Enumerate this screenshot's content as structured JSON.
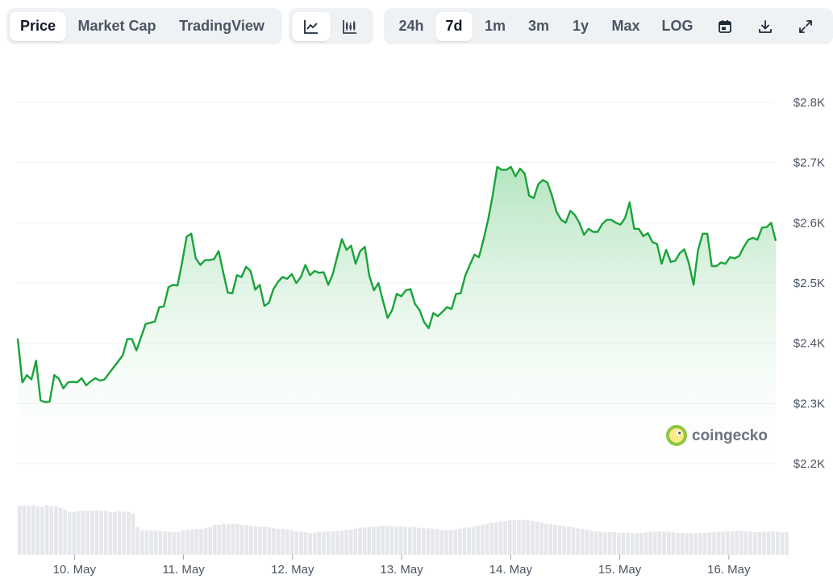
{
  "toolbar": {
    "tabs": [
      {
        "label": "Price",
        "active": true
      },
      {
        "label": "Market Cap",
        "active": false
      },
      {
        "label": "TradingView",
        "active": false
      }
    ],
    "chart_types": [
      {
        "icon": "line-chart-icon",
        "active": true
      },
      {
        "icon": "candlestick-chart-icon",
        "active": false
      }
    ],
    "ranges": [
      {
        "label": "24h",
        "active": false
      },
      {
        "label": "7d",
        "active": true
      },
      {
        "label": "1m",
        "active": false
      },
      {
        "label": "3m",
        "active": false
      },
      {
        "label": "1y",
        "active": false
      },
      {
        "label": "Max",
        "active": false
      }
    ],
    "log_label": "LOG",
    "action_icons": [
      "calendar-icon",
      "download-icon",
      "fullscreen-icon"
    ]
  },
  "watermark": {
    "text": "coingecko",
    "icon": "coingecko-logo-icon"
  },
  "colors": {
    "line": "#1aa33a",
    "fill_top": "#a7e0b4",
    "volume": "#e5e7eb",
    "grid": "#eef0f3"
  },
  "chart_data": {
    "type": "area",
    "ylim": [
      2200,
      2800
    ],
    "yticks": [
      2200,
      2300,
      2400,
      2500,
      2600,
      2700,
      2800
    ],
    "ytick_labels": [
      "$2.2K",
      "$2.3K",
      "$2.4K",
      "$2.5K",
      "$2.6K",
      "$2.7K",
      "$2.8K"
    ],
    "xtick_labels": [
      "10. May",
      "11. May",
      "12. May",
      "13. May",
      "14. May",
      "15. May",
      "16. May"
    ],
    "x_start_day": 9.48,
    "x_end_day": 16.43,
    "grid": true,
    "series": [
      {
        "values": [
          2408,
          2335,
          2347,
          2340,
          2371,
          2305,
          2302,
          2303,
          2347,
          2341,
          2325,
          2335,
          2336,
          2335,
          2342,
          2330,
          2337,
          2342,
          2338,
          2340,
          2350,
          2360,
          2370,
          2380,
          2407,
          2407,
          2388,
          2410,
          2432,
          2434,
          2436,
          2460,
          2461,
          2493,
          2497,
          2496,
          2535,
          2577,
          2582,
          2541,
          2530,
          2538,
          2538,
          2540,
          2553,
          2518,
          2484,
          2483,
          2513,
          2510,
          2527,
          2520,
          2489,
          2497,
          2462,
          2467,
          2490,
          2502,
          2510,
          2507,
          2515,
          2500,
          2510,
          2530,
          2513,
          2520,
          2517,
          2518,
          2497,
          2515,
          2545,
          2573,
          2555,
          2562,
          2532,
          2553,
          2560,
          2512,
          2488,
          2500,
          2470,
          2442,
          2455,
          2482,
          2478,
          2488,
          2490,
          2465,
          2455,
          2435,
          2425,
          2450,
          2445,
          2452,
          2460,
          2457,
          2482,
          2483,
          2512,
          2530,
          2547,
          2543,
          2572,
          2605,
          2645,
          2693,
          2688,
          2688,
          2693,
          2677,
          2690,
          2682,
          2645,
          2641,
          2664,
          2671,
          2667,
          2645,
          2618,
          2605,
          2600,
          2620,
          2613,
          2600,
          2580,
          2590,
          2585,
          2585,
          2598,
          2605,
          2605,
          2600,
          2597,
          2608,
          2634,
          2590,
          2590,
          2578,
          2583,
          2568,
          2565,
          2532,
          2555,
          2535,
          2537,
          2550,
          2556,
          2532,
          2497,
          2555,
          2582,
          2582,
          2528,
          2528,
          2534,
          2532,
          2543,
          2541,
          2545,
          2560,
          2572,
          2575,
          2572,
          2592,
          2593,
          2600,
          2570
        ],
        "volume": [
          0.98,
          0.98,
          0.98,
          0.99,
          0.97,
          0.96,
          0.99,
          0.97,
          0.97,
          0.94,
          0.9,
          0.86,
          0.86,
          0.87,
          0.88,
          0.88,
          0.88,
          0.89,
          0.88,
          0.88,
          0.85,
          0.86,
          0.87,
          0.86,
          0.86,
          0.83,
          0.55,
          0.49,
          0.49,
          0.49,
          0.49,
          0.48,
          0.47,
          0.46,
          0.45,
          0.45,
          0.49,
          0.5,
          0.51,
          0.51,
          0.52,
          0.54,
          0.56,
          0.6,
          0.6,
          0.62,
          0.61,
          0.62,
          0.61,
          0.6,
          0.59,
          0.58,
          0.57,
          0.56,
          0.56,
          0.55,
          0.53,
          0.52,
          0.52,
          0.51,
          0.49,
          0.47,
          0.46,
          0.45,
          0.43,
          0.44,
          0.46,
          0.46,
          0.47,
          0.47,
          0.48,
          0.48,
          0.5,
          0.5,
          0.52,
          0.54,
          0.55,
          0.56,
          0.57,
          0.57,
          0.58,
          0.58,
          0.58,
          0.56,
          0.57,
          0.56,
          0.55,
          0.56,
          0.54,
          0.53,
          0.53,
          0.52,
          0.51,
          0.49,
          0.49,
          0.5,
          0.5,
          0.52,
          0.54,
          0.55,
          0.56,
          0.58,
          0.6,
          0.62,
          0.64,
          0.65,
          0.67,
          0.67,
          0.69,
          0.69,
          0.69,
          0.7,
          0.69,
          0.68,
          0.66,
          0.64,
          0.62,
          0.61,
          0.6,
          0.59,
          0.58,
          0.57,
          0.55,
          0.53,
          0.52,
          0.5,
          0.48,
          0.47,
          0.46,
          0.45,
          0.45,
          0.45,
          0.44,
          0.44,
          0.44,
          0.43,
          0.43,
          0.44,
          0.45,
          0.46,
          0.46,
          0.47,
          0.46,
          0.46,
          0.45,
          0.44,
          0.44,
          0.43,
          0.43,
          0.43,
          0.44,
          0.44,
          0.45,
          0.45,
          0.46,
          0.46,
          0.47,
          0.47,
          0.48,
          0.48,
          0.47,
          0.46,
          0.45,
          0.45,
          0.46,
          0.47,
          0.47,
          0.46,
          0.45,
          0.45
        ]
      }
    ]
  }
}
